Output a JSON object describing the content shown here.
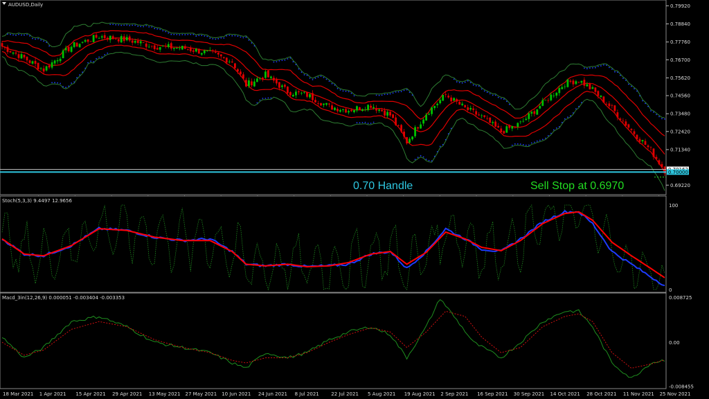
{
  "header": {
    "symbol": "AUDUSD,Daily",
    "stoch_label": "Stoch(5,3,3) 9.4497 12.9656",
    "macd_label": "Macd_3in(12,26,9) 0.000051 -0.003404 -0.003353"
  },
  "annotations": {
    "handle_text": "0.70 Handle",
    "sell_stop_text": "Sell Stop at 0.6970"
  },
  "colors": {
    "background": "#000000",
    "bull": "#00c000",
    "bear": "#e00000",
    "band_red": "#e00000",
    "band_green": "#2e7d32",
    "psar_blue": "#1e3cff",
    "handle_line": "#2ec7e0",
    "stoch_main": "#1e3cff",
    "stoch_signal": "#ff0000",
    "stoch_raw": "#1f8f1f",
    "macd_main": "#1f8f1f",
    "macd_signal": "#d01010",
    "grid": "#9a9a9a"
  },
  "chart_data": [
    {
      "type": "candlestick",
      "title": "AUDUSD,Daily",
      "ylim": [
        0.689,
        0.801
      ],
      "y_ticks": [
        "0.79920",
        "0.78840",
        "0.77760",
        "0.76700",
        "0.75620",
        "0.74560",
        "0.73480",
        "0.72420",
        "0.71340",
        "0.70162",
        "0.70000",
        "0.69220"
      ],
      "price_badges": [
        {
          "label": "0.70162",
          "value": 0.70162
        },
        {
          "label": "0.70000",
          "value": 0.7
        }
      ],
      "handle_level": 0.7,
      "sell_stop": 0.697,
      "x_labels": [
        "18 Mar 2021",
        "1 Apr 2021",
        "15 Apr 2021",
        "29 Apr 2021",
        "13 May 2021",
        "27 May 2021",
        "10 Jun 2021",
        "24 Jun 2021",
        "8 Jul 2021",
        "22 Jul 2021",
        "5 Aug 2021",
        "19 Aug 2021",
        "2 Sep 2021",
        "16 Sep 2021",
        "30 Sep 2021",
        "14 Oct 2021",
        "28 Oct 2021",
        "11 Nov 2021",
        "25 Nov 2021"
      ],
      "close_anchors": [
        [
          0,
          0.775
        ],
        [
          8,
          0.768
        ],
        [
          15,
          0.761
        ],
        [
          25,
          0.775
        ],
        [
          35,
          0.781
        ],
        [
          45,
          0.779
        ],
        [
          55,
          0.775
        ],
        [
          65,
          0.774
        ],
        [
          75,
          0.771
        ],
        [
          83,
          0.766
        ],
        [
          88,
          0.752
        ],
        [
          95,
          0.758
        ],
        [
          103,
          0.748
        ],
        [
          110,
          0.746
        ],
        [
          118,
          0.739
        ],
        [
          125,
          0.737
        ],
        [
          133,
          0.74
        ],
        [
          140,
          0.734
        ],
        [
          146,
          0.718
        ],
        [
          153,
          0.735
        ],
        [
          160,
          0.746
        ],
        [
          167,
          0.738
        ],
        [
          173,
          0.733
        ],
        [
          180,
          0.724
        ],
        [
          187,
          0.729
        ],
        [
          195,
          0.741
        ],
        [
          203,
          0.753
        ],
        [
          208,
          0.755
        ],
        [
          213,
          0.749
        ],
        [
          220,
          0.738
        ],
        [
          227,
          0.725
        ],
        [
          234,
          0.713
        ],
        [
          239,
          0.701
        ]
      ]
    },
    {
      "type": "line",
      "title": "Stoch(5,3,3) 9.4497 12.9656",
      "ylim": [
        0,
        100
      ],
      "y_ticks": [
        "100",
        "0"
      ],
      "main_anchors": [
        [
          0,
          60
        ],
        [
          8,
          42
        ],
        [
          15,
          40
        ],
        [
          25,
          52
        ],
        [
          35,
          72
        ],
        [
          45,
          70
        ],
        [
          55,
          62
        ],
        [
          65,
          58
        ],
        [
          75,
          60
        ],
        [
          83,
          45
        ],
        [
          88,
          30
        ],
        [
          95,
          28
        ],
        [
          103,
          30
        ],
        [
          110,
          27
        ],
        [
          118,
          28
        ],
        [
          125,
          30
        ],
        [
          133,
          42
        ],
        [
          140,
          45
        ],
        [
          146,
          25
        ],
        [
          153,
          45
        ],
        [
          160,
          72
        ],
        [
          167,
          60
        ],
        [
          173,
          48
        ],
        [
          180,
          45
        ],
        [
          187,
          60
        ],
        [
          195,
          80
        ],
        [
          203,
          92
        ],
        [
          208,
          92
        ],
        [
          213,
          78
        ],
        [
          220,
          45
        ],
        [
          227,
          30
        ],
        [
          234,
          15
        ],
        [
          239,
          5
        ]
      ],
      "signal_anchors": [
        [
          0,
          60
        ],
        [
          8,
          42
        ],
        [
          15,
          40
        ],
        [
          25,
          52
        ],
        [
          35,
          72
        ],
        [
          45,
          70
        ],
        [
          55,
          62
        ],
        [
          65,
          58
        ],
        [
          75,
          58
        ],
        [
          83,
          45
        ],
        [
          88,
          30
        ],
        [
          95,
          28
        ],
        [
          103,
          30
        ],
        [
          110,
          27
        ],
        [
          118,
          28
        ],
        [
          125,
          32
        ],
        [
          133,
          42
        ],
        [
          140,
          45
        ],
        [
          146,
          30
        ],
        [
          153,
          44
        ],
        [
          160,
          68
        ],
        [
          167,
          60
        ],
        [
          173,
          50
        ],
        [
          180,
          46
        ],
        [
          187,
          58
        ],
        [
          195,
          78
        ],
        [
          203,
          90
        ],
        [
          208,
          92
        ],
        [
          213,
          82
        ],
        [
          220,
          56
        ],
        [
          227,
          40
        ],
        [
          234,
          25
        ],
        [
          239,
          14
        ]
      ]
    },
    {
      "type": "line",
      "title": "Macd_3in(12,26,9) 0.000051 -0.003404 -0.003353",
      "ylim": [
        -0.00855,
        0.00885
      ],
      "y_ticks": [
        "0.008725",
        "0.00",
        "-0.008455"
      ],
      "main_anchors": [
        [
          0,
          0.001
        ],
        [
          8,
          -0.003
        ],
        [
          15,
          -0.001
        ],
        [
          25,
          0.004
        ],
        [
          35,
          0.005
        ],
        [
          45,
          0.003
        ],
        [
          55,
          0.0
        ],
        [
          65,
          -0.001
        ],
        [
          75,
          -0.002
        ],
        [
          83,
          -0.004
        ],
        [
          88,
          -0.005
        ],
        [
          95,
          -0.002
        ],
        [
          103,
          -0.003
        ],
        [
          110,
          -0.002
        ],
        [
          118,
          0.0005
        ],
        [
          125,
          0.002
        ],
        [
          133,
          0.003
        ],
        [
          140,
          0.0015
        ],
        [
          146,
          -0.003
        ],
        [
          153,
          0.003
        ],
        [
          158,
          0.0085
        ],
        [
          163,
          0.005
        ],
        [
          170,
          0.0
        ],
        [
          180,
          -0.003
        ],
        [
          187,
          0.0
        ],
        [
          195,
          0.004
        ],
        [
          203,
          0.006
        ],
        [
          208,
          0.006
        ],
        [
          213,
          0.003
        ],
        [
          220,
          -0.004
        ],
        [
          227,
          -0.007
        ],
        [
          234,
          -0.004
        ],
        [
          239,
          -0.0034
        ]
      ],
      "signal_anchors": [
        [
          0,
          0.0
        ],
        [
          8,
          -0.0025
        ],
        [
          15,
          -0.0015
        ],
        [
          25,
          0.0025
        ],
        [
          35,
          0.004
        ],
        [
          45,
          0.003
        ],
        [
          55,
          0.0005
        ],
        [
          65,
          -0.001
        ],
        [
          75,
          -0.002
        ],
        [
          83,
          -0.0035
        ],
        [
          88,
          -0.004
        ],
        [
          95,
          -0.003
        ],
        [
          103,
          -0.003
        ],
        [
          110,
          -0.002
        ],
        [
          118,
          0.0
        ],
        [
          125,
          0.0015
        ],
        [
          133,
          0.0028
        ],
        [
          140,
          0.002
        ],
        [
          146,
          -0.001
        ],
        [
          153,
          0.002
        ],
        [
          160,
          0.006
        ],
        [
          167,
          0.005
        ],
        [
          173,
          0.001
        ],
        [
          180,
          -0.002
        ],
        [
          187,
          -0.001
        ],
        [
          195,
          0.003
        ],
        [
          203,
          0.005
        ],
        [
          208,
          0.0055
        ],
        [
          213,
          0.004
        ],
        [
          220,
          -0.002
        ],
        [
          227,
          -0.005
        ],
        [
          234,
          -0.0042
        ],
        [
          239,
          -0.0034
        ]
      ]
    }
  ]
}
